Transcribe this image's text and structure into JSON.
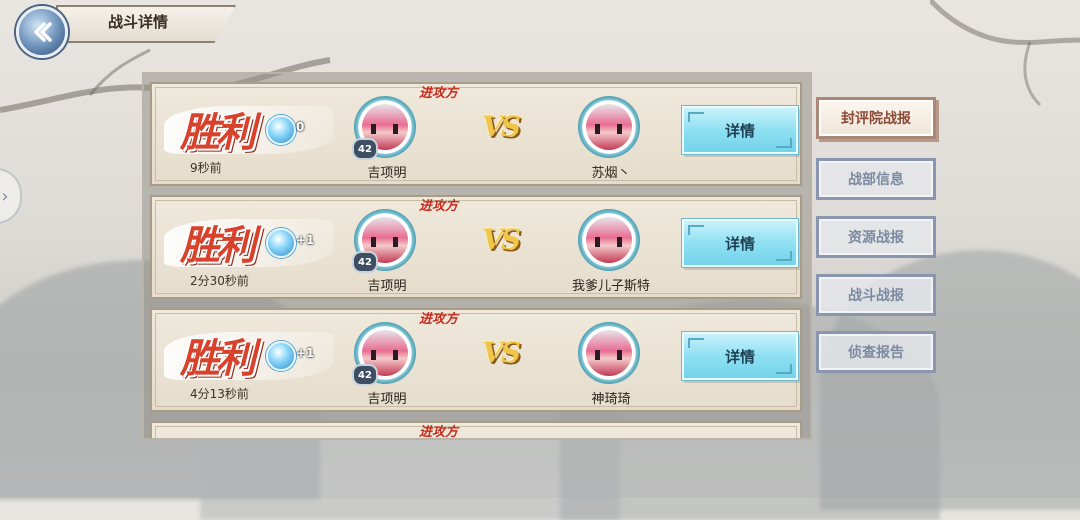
{
  "header": {
    "title": "战斗详情",
    "back_icon": "back-arrow-icon"
  },
  "reports": [
    {
      "result": "胜利",
      "gem_icon": "diamond-icon",
      "gem_change": "0",
      "time": "9秒前",
      "attacker_tag": "进攻方",
      "left_player": {
        "name": "吉项明",
        "level": "42"
      },
      "vs": "VS",
      "right_player": {
        "name": "苏烟丶"
      },
      "detail_label": "详情"
    },
    {
      "result": "胜利",
      "gem_icon": "diamond-icon",
      "gem_change": "+1",
      "time": "2分30秒前",
      "attacker_tag": "进攻方",
      "left_player": {
        "name": "吉项明",
        "level": "42"
      },
      "vs": "VS",
      "right_player": {
        "name": "我爹儿子斯特"
      },
      "detail_label": "详情"
    },
    {
      "result": "胜利",
      "gem_icon": "diamond-icon",
      "gem_change": "+1",
      "time": "4分13秒前",
      "attacker_tag": "进攻方",
      "left_player": {
        "name": "吉项明",
        "level": "42"
      },
      "vs": "VS",
      "right_player": {
        "name": "神琦琦"
      },
      "detail_label": "详情"
    },
    {
      "attacker_tag": "进攻方"
    }
  ],
  "tabs": [
    {
      "label": "封评院战报",
      "active": true
    },
    {
      "label": "战部信息",
      "active": false
    },
    {
      "label": "资源战报",
      "active": false
    },
    {
      "label": "战斗战报",
      "active": false
    },
    {
      "label": "侦查报告",
      "active": false
    }
  ],
  "colors": {
    "victory_red": "#d8412b",
    "detail_button": "#8fe0f2",
    "active_tab_text": "#8b4a38",
    "inactive_tab_text": "#7b8aa0"
  }
}
